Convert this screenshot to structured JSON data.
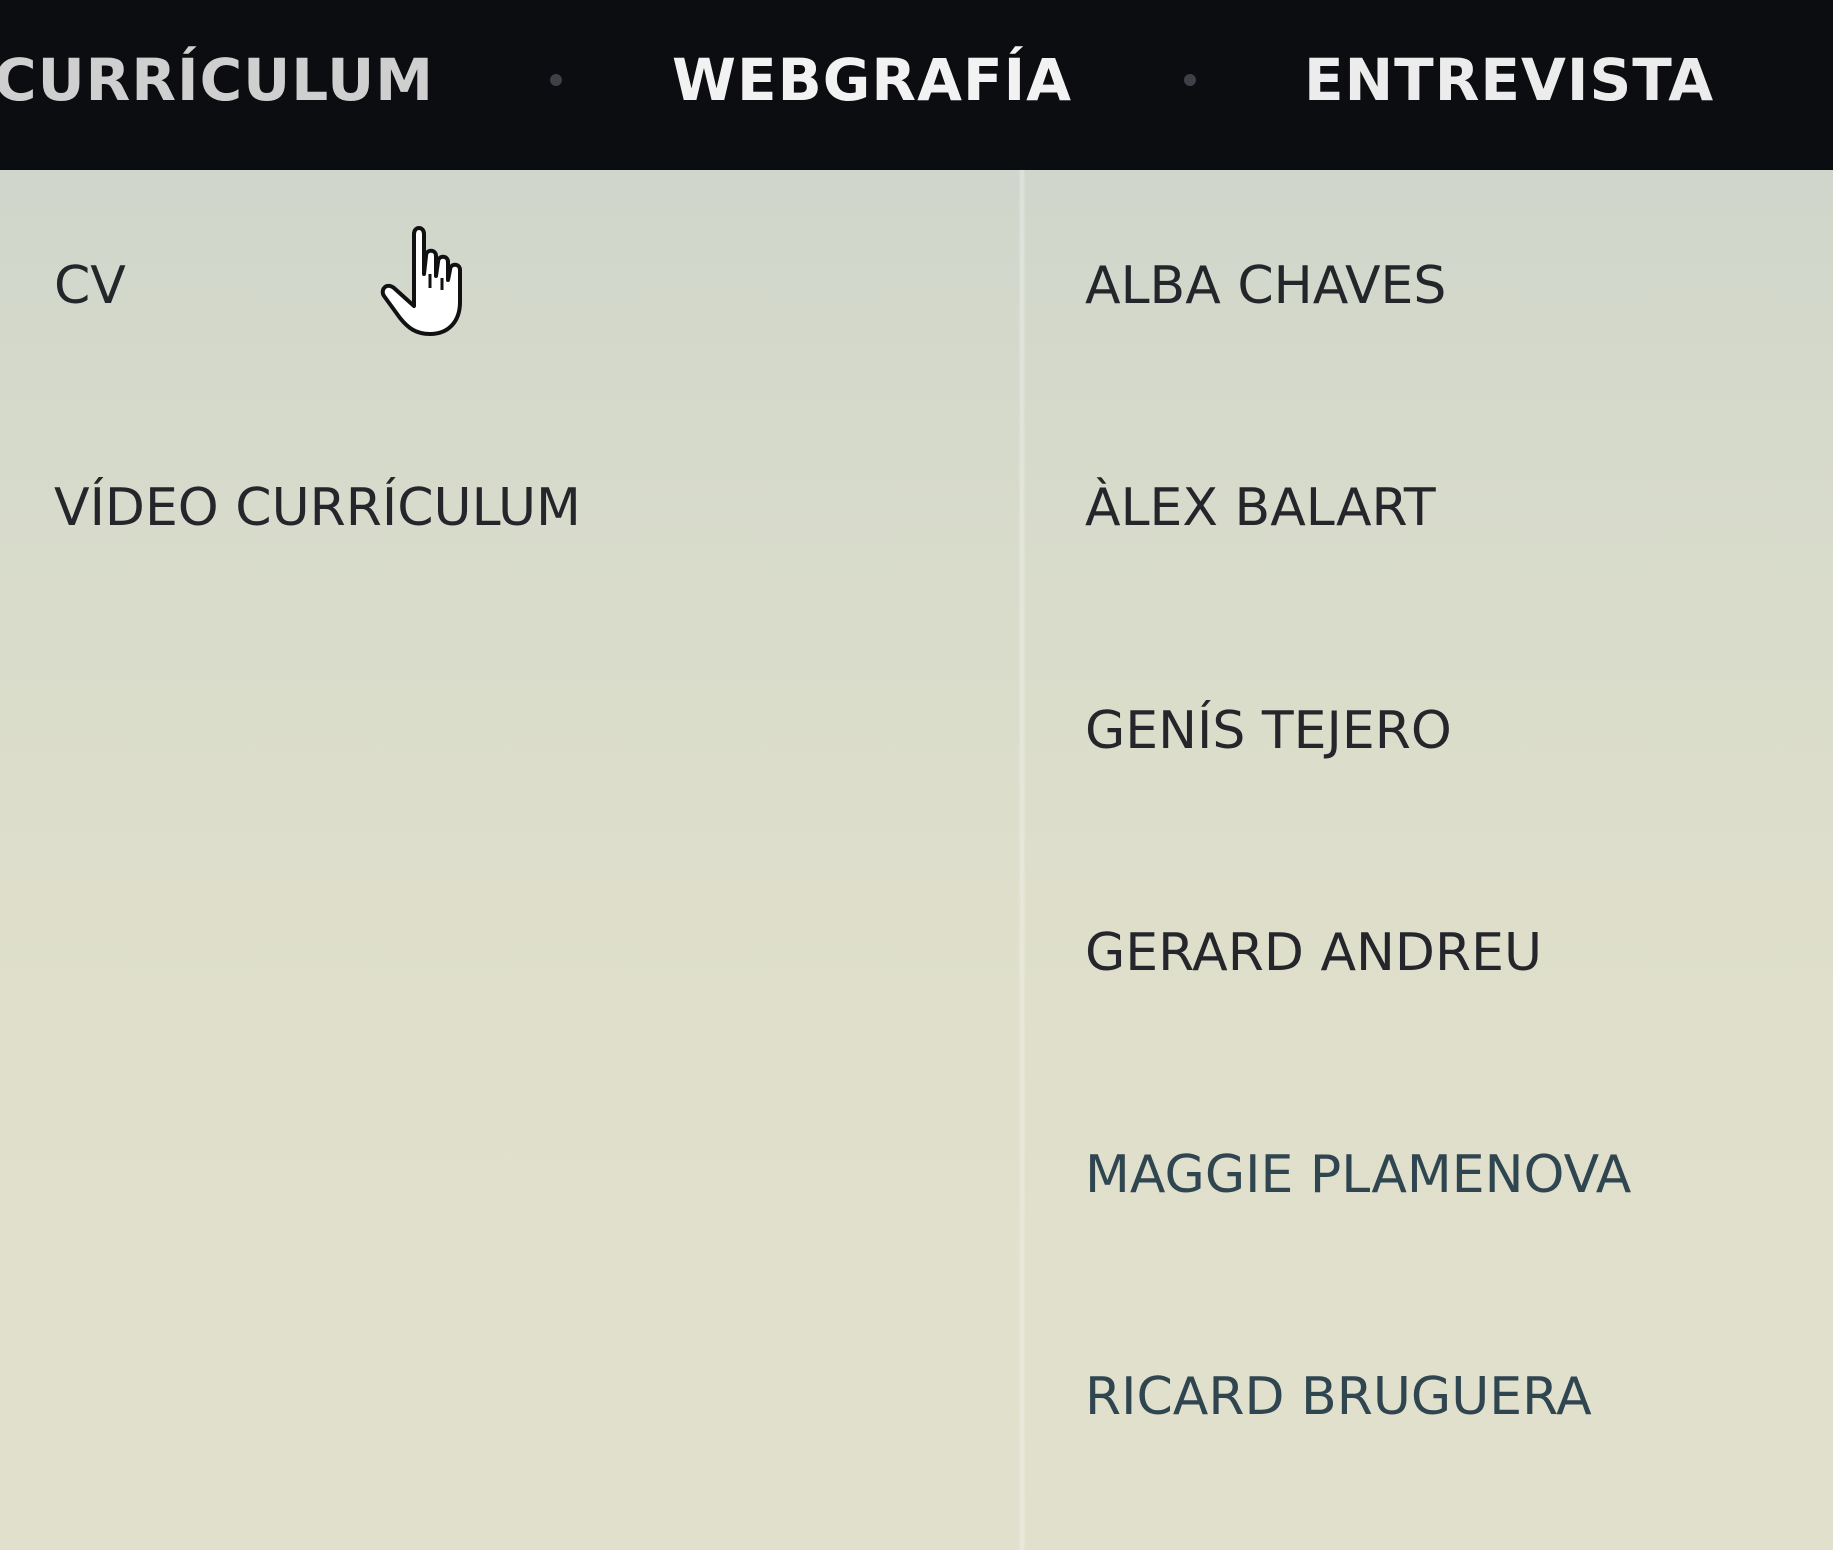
{
  "nav": {
    "items": [
      "CURRÍCULUM",
      "WEBGRAFÍA",
      "ENTREVISTA"
    ]
  },
  "dropdown": {
    "left_items": [
      "CV",
      "VÍDEO CURRÍCULUM"
    ],
    "right_items": [
      "ALBA CHAVES",
      "ÀLEX BALART",
      "GENÍS TEJERO",
      "GERARD ANDREU",
      "MAGGIE PLAMENOVA",
      "RICARD BRUGUERA"
    ]
  },
  "colors": {
    "navbar_bg": "#0c0d10",
    "dropdown_bg": "#dcdccd",
    "menu_text": "#24262b"
  },
  "icons": {
    "cursor": "hand-pointer-icon",
    "separator": "dot-separator-icon"
  }
}
